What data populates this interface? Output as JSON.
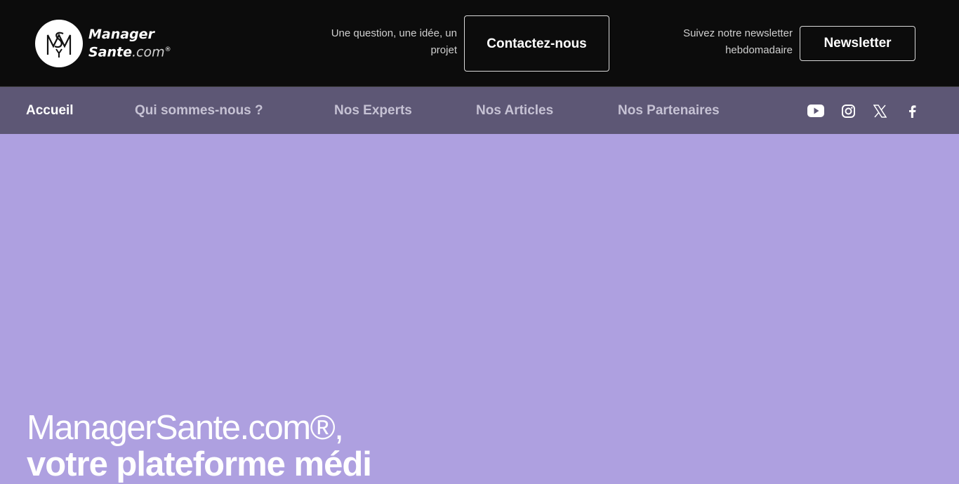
{
  "header": {
    "logo": {
      "word1": "Manager",
      "word2": "Sante",
      "word3": ".com",
      "mark": "®",
      "monogram": "MS"
    },
    "contact_prompt": "Une question, une idée, un projet",
    "contact_label": "Contactez-nous",
    "newsletter_prompt": "Suivez notre newsletter hebdomadaire",
    "newsletter_label": "Newsletter"
  },
  "nav": {
    "items": [
      {
        "label": "Accueil",
        "active": true
      },
      {
        "label": "Qui sommes-nous ?"
      },
      {
        "label": "Nos Experts"
      },
      {
        "label": "Nos Articles"
      },
      {
        "label": "Nos Partenaires"
      }
    ],
    "social": [
      "youtube-icon",
      "instagram-icon",
      "x-icon",
      "facebook-icon"
    ]
  },
  "hero": {
    "title": "ManagerSante.com®,",
    "subtitle_partial": "votre plateforme médi"
  },
  "colors": {
    "topbar": "#0c0c0c",
    "navbar": "#5d5775",
    "hero_bg": "#aea0e0"
  }
}
